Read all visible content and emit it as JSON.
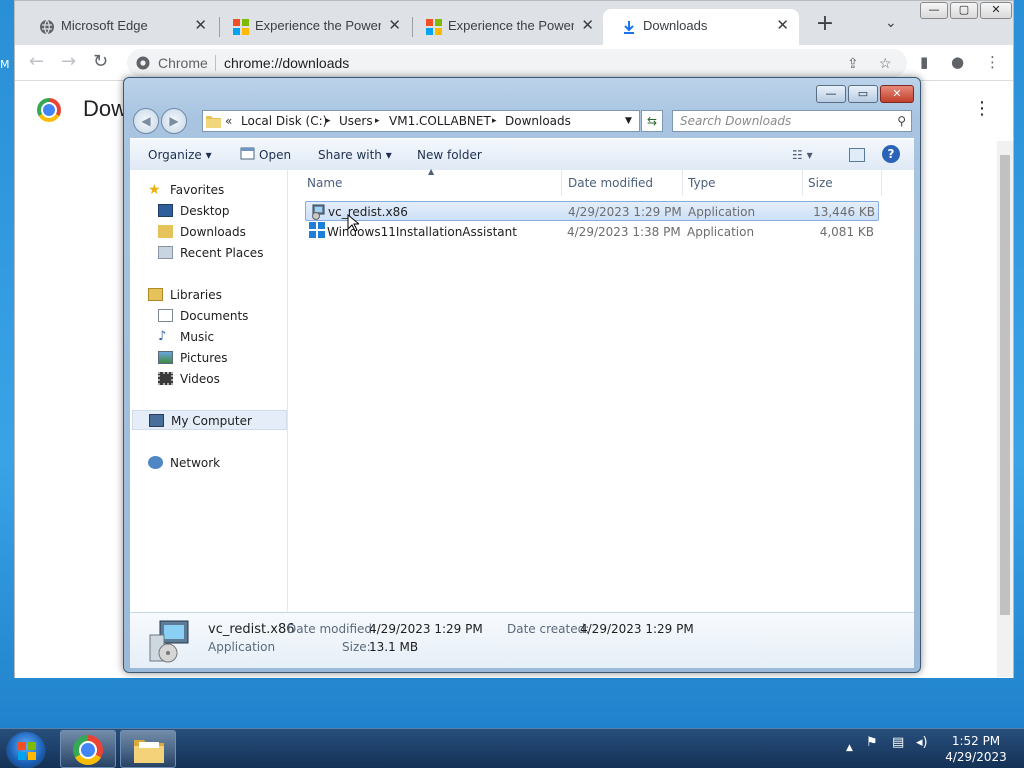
{
  "desktop": {
    "edge_letters": [
      "M",
      "M"
    ]
  },
  "chrome": {
    "tabs": [
      {
        "title": "Microsoft Edge",
        "icon": "edge-globe-icon"
      },
      {
        "title": "Experience the Power of",
        "icon": "microsoft-logo-icon"
      },
      {
        "title": "Experience the Power of",
        "icon": "microsoft-logo-icon"
      },
      {
        "title": "Downloads",
        "icon": "download-icon"
      }
    ],
    "tab_close": "✕",
    "new_tab": "+",
    "tab_search": "⌄",
    "window_controls": {
      "minimize": "—",
      "maximize": "▢",
      "close": "✕"
    },
    "toolbar": {
      "back": "←",
      "forward": "→",
      "reload": "↻",
      "omnibox_label": "Chrome",
      "omnibox_url": "chrome://downloads",
      "share": "⇪",
      "bookmark": "☆",
      "sidepanel": "▮",
      "profile": "●",
      "menu": "⋮"
    },
    "page_title": "Downloads",
    "page_menu": "⋮"
  },
  "explorer": {
    "window_controls": {
      "minimize": "—",
      "maximize": "▭",
      "close": "✕"
    },
    "breadcrumb": [
      "Local Disk (C:)",
      "Users",
      "VM1.COLLABNET",
      "Downloads"
    ],
    "breadcrumb_prefix": "«",
    "breadcrumb_sep": "▸",
    "search_placeholder": "Search Downloads",
    "toolbar": {
      "organize": "Organize",
      "open": "Open",
      "share_with": "Share with",
      "new_folder": "New folder"
    },
    "nav": {
      "favorites": "Favorites",
      "desktop": "Desktop",
      "downloads": "Downloads",
      "recent_places": "Recent Places",
      "libraries": "Libraries",
      "documents": "Documents",
      "music": "Music",
      "pictures": "Pictures",
      "videos": "Videos",
      "my_computer": "My Computer",
      "network": "Network"
    },
    "columns": {
      "name": "Name",
      "date": "Date modified",
      "type": "Type",
      "size": "Size"
    },
    "files": [
      {
        "name": "vc_redist.x86",
        "date": "4/29/2023 1:29 PM",
        "type": "Application",
        "size": "13,446 KB",
        "selected": true
      },
      {
        "name": "Windows11InstallationAssistant",
        "date": "4/29/2023 1:38 PM",
        "type": "Application",
        "size": "4,081 KB",
        "selected": false
      }
    ],
    "details": {
      "name": "vc_redist.x86",
      "kind": "Application",
      "date_modified_label": "Date modified:",
      "date_modified": "4/29/2023 1:29 PM",
      "date_created_label": "Date created:",
      "date_created": "4/29/2023 1:29 PM",
      "size_label": "Size:",
      "size": "13.1 MB"
    }
  },
  "taskbar": {
    "time": "1:52 PM",
    "date": "4/29/2023",
    "tray_up": "▲"
  }
}
